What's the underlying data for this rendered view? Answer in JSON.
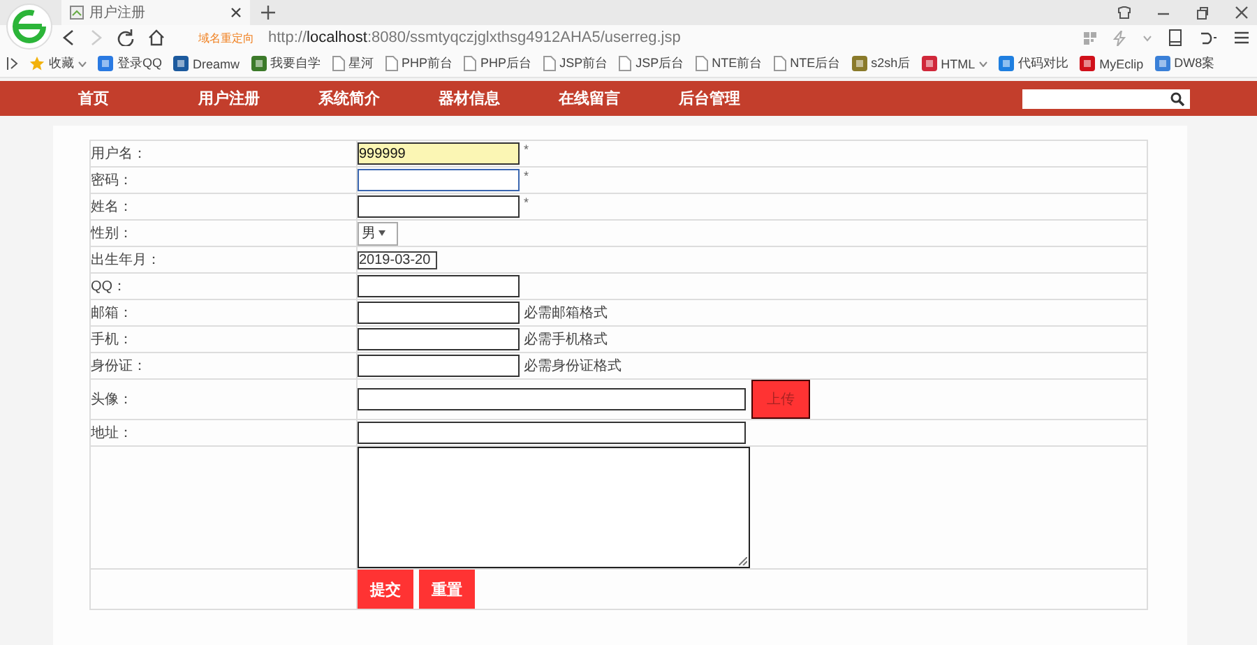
{
  "browser": {
    "tab_title": "用户注册",
    "redirect_label": "域名重定向",
    "url": "http://**localhost**:8080/ssmtyqczjglxthsg4912AHA5/userreg.jsp"
  },
  "bookmarks": [
    {
      "label": "收藏",
      "kind": "star",
      "dropdown": true
    },
    {
      "label": "登录QQ",
      "kind": "app",
      "color": "#2a7ae2"
    },
    {
      "label": "Dreamw",
      "kind": "app",
      "color": "#1c5a9e"
    },
    {
      "label": "我要自学",
      "kind": "app",
      "color": "#3c7a2a"
    },
    {
      "label": "星河",
      "kind": "page"
    },
    {
      "label": "PHP前台",
      "kind": "page"
    },
    {
      "label": "PHP后台",
      "kind": "page"
    },
    {
      "label": "JSP前台",
      "kind": "page"
    },
    {
      "label": "JSP后台",
      "kind": "page"
    },
    {
      "label": "NTE前台",
      "kind": "page"
    },
    {
      "label": "NTE后台",
      "kind": "page"
    },
    {
      "label": "s2sh后",
      "kind": "app",
      "color": "#8a7a2a"
    },
    {
      "label": "HTML",
      "kind": "app",
      "color": "#d0283a",
      "dropdown": true
    },
    {
      "label": "代码对比",
      "kind": "app",
      "color": "#1f7fe0"
    },
    {
      "label": "MyEclip",
      "kind": "app",
      "color": "#d0101a"
    },
    {
      "label": "DW8案",
      "kind": "app",
      "color": "#3a80d8"
    }
  ],
  "nav": {
    "items": [
      "首页",
      "用户注册",
      "系统简介",
      "器材信息",
      "在线留言",
      "后台管理"
    ]
  },
  "form": {
    "rows": [
      {
        "kind": "text",
        "label": "用户名：",
        "value": "999999",
        "highlighted": true,
        "focused": false,
        "required_mark": "*"
      },
      {
        "kind": "text",
        "label": "密码：",
        "highlighted": false,
        "focused": true,
        "required_mark": "*"
      },
      {
        "kind": "text",
        "label": "姓名：",
        "highlighted": false,
        "focused": false,
        "required_mark": "*"
      },
      {
        "kind": "select",
        "label": "性别：",
        "value": "男"
      },
      {
        "kind": "date",
        "label": "出生年月：",
        "value": "2019-03-20"
      },
      {
        "kind": "text",
        "label": "QQ：",
        "highlighted": false,
        "focused": false
      },
      {
        "kind": "text",
        "label": "邮箱：",
        "highlighted": false,
        "focused": false,
        "hint": "必需邮箱格式"
      },
      {
        "kind": "text",
        "label": "手机：",
        "highlighted": false,
        "focused": false,
        "hint": "必需手机格式"
      },
      {
        "kind": "text",
        "label": "身份证：",
        "highlighted": false,
        "focused": false,
        "hint": "必需身份证格式"
      },
      {
        "kind": "file",
        "label": "头像：",
        "button": "上传"
      },
      {
        "kind": "wide",
        "label": "地址："
      },
      {
        "kind": "textarea"
      },
      {
        "kind": "buttons",
        "buttons": [
          "提交",
          "重置"
        ]
      }
    ]
  }
}
